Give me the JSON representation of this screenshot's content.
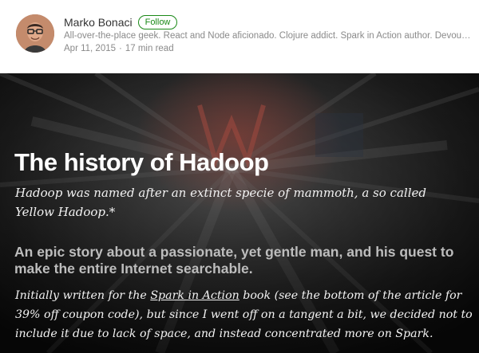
{
  "author": {
    "name": "Marko Bonaci",
    "follow_label": "Follow",
    "bio": "All-over-the-place geek. React and Node aficionado. Clojure addict. Spark in Action author. Devout ...",
    "date": "Apr 11, 2015",
    "separator": "·",
    "read_time": "17 min read"
  },
  "article": {
    "title": "The history of Hadoop",
    "subtitle": "Hadoop was named after an extinct specie of mammoth, a so called Yellow Hadoop.*",
    "tagline": "An epic story about a passionate, yet gentle man, and his quest to make the entire Internet searchable.",
    "intro_prefix": "Initially written for the ",
    "intro_link": "Spark in Action",
    "intro_suffix": " book (see the bottom of the article for 39% off coupon code), but since I went off on a tangent a bit, we decided not to include it due to lack of space, and instead concentrated more on Spark."
  }
}
